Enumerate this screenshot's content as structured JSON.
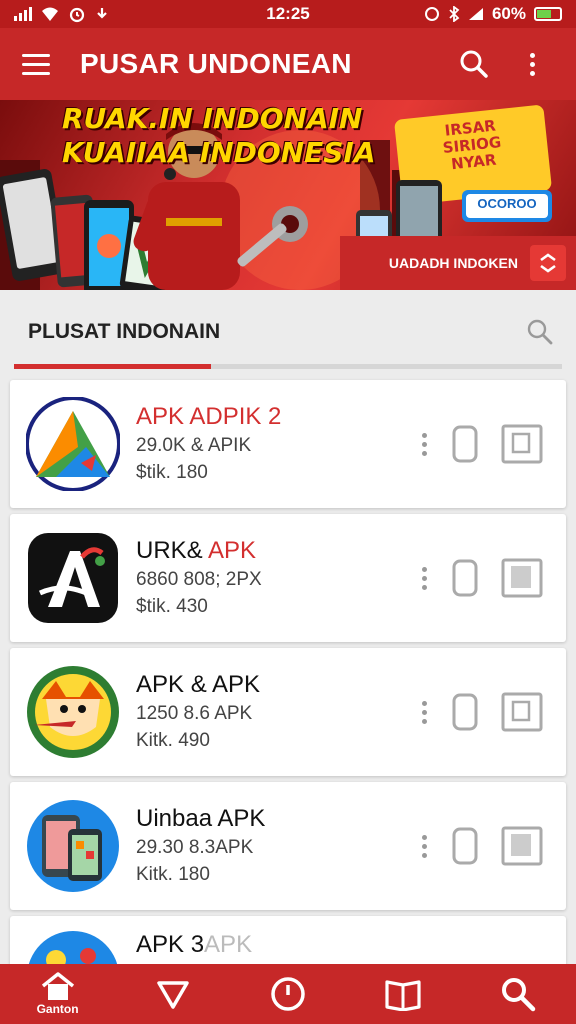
{
  "status": {
    "left_icons": [
      "signal-icon",
      "wifi-icon",
      "alarm-icon",
      "download-icon"
    ],
    "time": "12:25",
    "battery_text": "60%"
  },
  "appbar": {
    "title": "PUSAR UNDONEAN",
    "menu_icon": "menu-icon",
    "search_icon": "search-icon",
    "more_icon": "more-vert-icon"
  },
  "banner": {
    "headline_line1": "RUAK.IN INDONAIN",
    "headline_line2": "KUAIIAA INDONESIA",
    "strip_label": "UADADH INDOKEN",
    "badge_text": "IRSAR\nSIRIOG\nNYAR",
    "button_text": "OCOROO"
  },
  "section": {
    "tab_label": "PLUSAT INDONAIN",
    "progress_fraction": 0.36
  },
  "apps": [
    {
      "name": "APK ADPIK 2",
      "name_accent": "",
      "name_style": "accent",
      "meta1": "29.0K & APIK",
      "meta2": "$tik. 180",
      "icon": "app-icon-compass"
    },
    {
      "name": "URK& ",
      "name_accent": "APK",
      "name_style": "split",
      "meta1": "6860 808; 2PX",
      "meta2": "$tik. 430",
      "icon": "app-icon-letter-a"
    },
    {
      "name": "APK & APK",
      "name_accent": "",
      "name_style": "plain",
      "meta1": "1250 8.6 APK",
      "meta2": "Kitk. 490",
      "icon": "app-icon-character"
    },
    {
      "name": "Uinbaa APK",
      "name_accent": "",
      "name_style": "plain",
      "meta1": "29.30 8.3APK",
      "meta2": "Kitk. 180",
      "icon": "app-icon-phones"
    },
    {
      "name": "APK 3",
      "name_accent": "APK",
      "name_style": "faded",
      "meta1": "",
      "meta2": "",
      "icon": "app-icon-partial"
    }
  ],
  "bottom_nav": [
    {
      "icon": "home-icon",
      "label": "Ganton"
    },
    {
      "icon": "explore-icon",
      "label": ""
    },
    {
      "icon": "history-icon",
      "label": ""
    },
    {
      "icon": "book-icon",
      "label": ""
    },
    {
      "icon": "search-icon",
      "label": ""
    }
  ],
  "colors": {
    "primary": "#c62828",
    "accent_text": "#d32f2f",
    "headline": "#ffd600"
  }
}
